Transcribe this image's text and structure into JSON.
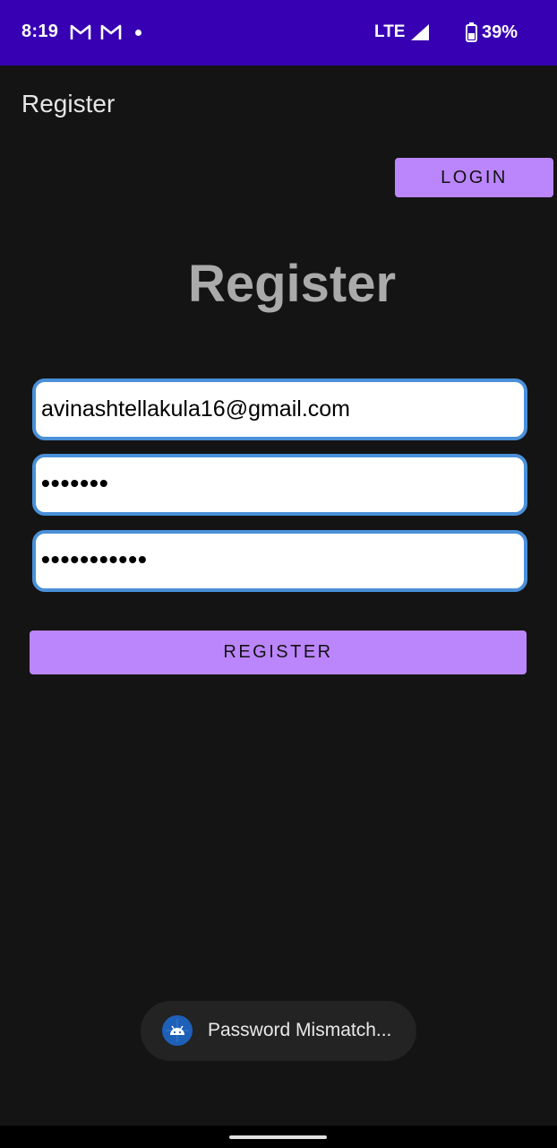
{
  "status_bar": {
    "time": "8:19",
    "notification_icons": [
      "gmail-icon",
      "gmail-icon",
      "dot-icon"
    ],
    "network": "LTE",
    "battery": "39%",
    "background": "#3700b3"
  },
  "app_bar": {
    "title": "Register"
  },
  "login_button": {
    "label": "LOGIN"
  },
  "heading": {
    "text": "Register"
  },
  "form": {
    "email_value": "avinashtellakula16@gmail.com",
    "password_value": "•••••••",
    "confirm_password_value": "•••••••••••"
  },
  "register_button": {
    "label": "REGISTER"
  },
  "toast": {
    "icon": "android-icon",
    "message": "Password Mismatch..."
  },
  "colors": {
    "accent": "#bb86fc",
    "background": "#141414",
    "field_border": "#4a90d9"
  }
}
